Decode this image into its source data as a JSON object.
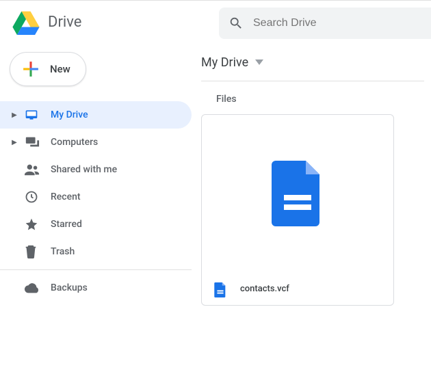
{
  "app": {
    "name": "Drive"
  },
  "search": {
    "placeholder": "Search Drive"
  },
  "newButton": {
    "label": "New"
  },
  "sidebar": {
    "items": [
      {
        "label": "My Drive"
      },
      {
        "label": "Computers"
      },
      {
        "label": "Shared with me"
      },
      {
        "label": "Recent"
      },
      {
        "label": "Starred"
      },
      {
        "label": "Trash"
      },
      {
        "label": "Backups"
      }
    ]
  },
  "breadcrumb": {
    "current": "My Drive"
  },
  "section": {
    "filesLabel": "Files"
  },
  "files": [
    {
      "name": "contacts.vcf"
    }
  ],
  "colors": {
    "accent": "#1a73e8",
    "muted": "#5f6368",
    "activeBg": "#e8f0fe",
    "fileBlue": "#1a73e8"
  }
}
